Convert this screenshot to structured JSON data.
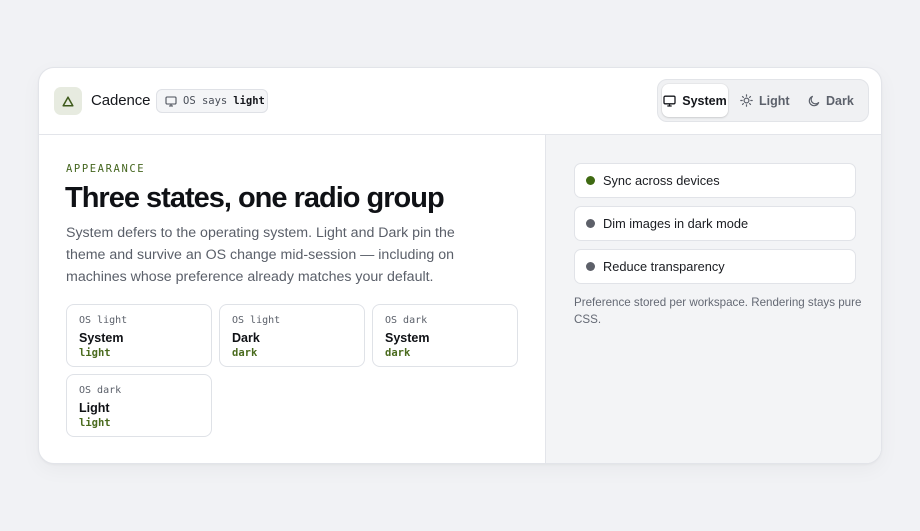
{
  "header": {
    "brand": "Cadence",
    "os_status": {
      "prefix": "OS says",
      "value": "light"
    },
    "theme_options": [
      {
        "label": "System",
        "icon": "monitor-icon",
        "selected": true
      },
      {
        "label": "Light",
        "icon": "sun-icon",
        "selected": false
      },
      {
        "label": "Dark",
        "icon": "moon-icon",
        "selected": false
      }
    ]
  },
  "main": {
    "eyebrow": "APPEARANCE",
    "title": "Three states, one radio group",
    "description": "System defers to the operating system. Light and Dark pin the theme and survive an OS change mid-session — including on machines whose preference already matches your default.",
    "states": [
      {
        "os": "OS light",
        "choice": "System",
        "result": "light"
      },
      {
        "os": "OS light",
        "choice": "Dark",
        "result": "dark"
      },
      {
        "os": "OS dark",
        "choice": "System",
        "result": "dark"
      },
      {
        "os": "OS dark",
        "choice": "Light",
        "result": "light"
      }
    ]
  },
  "sidebar": {
    "options": [
      {
        "label": "Sync across devices",
        "enabled": true
      },
      {
        "label": "Dim images in dark mode",
        "enabled": false
      },
      {
        "label": "Reduce transparency",
        "enabled": false
      }
    ],
    "footnote": "Preference stored per workspace. Rendering stays pure CSS."
  },
  "colors": {
    "accent": "#45661f",
    "dot_on": "#3f6a12",
    "dot_off": "#5d6069",
    "page_bg": "#f1f2f5"
  }
}
